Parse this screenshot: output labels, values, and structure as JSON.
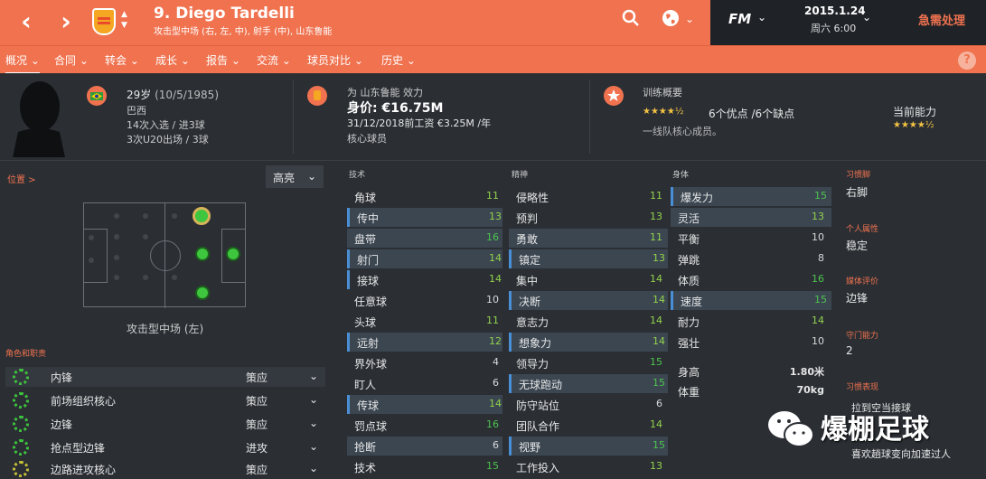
{
  "header": {
    "title": "9. Diego Tardelli",
    "subtitle": "攻击型中场 (右, 左, 中), 射手 (中), 山东鲁能",
    "fm_label": "FM",
    "date": "2015.1.24",
    "day_time": "周六 6:00",
    "urgent_label": "急需处理"
  },
  "menu": [
    "概况",
    "合同",
    "转会",
    "成长",
    "报告",
    "交流",
    "球员对比",
    "历史"
  ],
  "info": {
    "age": "29岁",
    "birth": "(10/5/1985)",
    "nation": "巴西",
    "caps": "14次入选 / 进3球",
    "u20": "3次U20出场 / 3球",
    "club_line": "为 山东鲁能 效力",
    "value_label": "身价: €16.75M",
    "contract": "31/12/2018前工资 €3.25M /年",
    "squad_status": "核心球员",
    "training_label": "训练概要",
    "strengths": "6个优点 /6个缺点",
    "training_sub": "一线队核心成员。",
    "current_ability_label": "当前能力"
  },
  "position_panel": {
    "title": "位置 >",
    "dropdown": "高亮",
    "position_label": "攻击型中场 (左)",
    "roles_title": "角色和职责",
    "roles": [
      {
        "name": "内锋",
        "duty": "策应"
      },
      {
        "name": "前场组织核心",
        "duty": "策应"
      },
      {
        "name": "边锋",
        "duty": "策应"
      },
      {
        "name": "抢点型边锋",
        "duty": "进攻"
      },
      {
        "name": "边路进攻核心",
        "duty": "策应"
      }
    ]
  },
  "attributes": {
    "technical_head": "技术",
    "mental_head": "精神",
    "physical_head": "身体",
    "technical": [
      {
        "name": "角球",
        "value": "11"
      },
      {
        "name": "传中",
        "value": "13"
      },
      {
        "name": "盘带",
        "value": "16"
      },
      {
        "name": "射门",
        "value": "14"
      },
      {
        "name": "接球",
        "value": "14"
      },
      {
        "name": "任意球",
        "value": "10"
      },
      {
        "name": "头球",
        "value": "11"
      },
      {
        "name": "远射",
        "value": "12"
      },
      {
        "name": "界外球",
        "value": "4"
      },
      {
        "name": "盯人",
        "value": "6"
      },
      {
        "name": "传球",
        "value": "14"
      },
      {
        "name": "罚点球",
        "value": "16"
      },
      {
        "name": "抢断",
        "value": "6"
      },
      {
        "name": "技术",
        "value": "15"
      }
    ],
    "mental": [
      {
        "name": "侵略性",
        "value": "11"
      },
      {
        "name": "预判",
        "value": "13"
      },
      {
        "name": "勇敢",
        "value": "11"
      },
      {
        "name": "镇定",
        "value": "13"
      },
      {
        "name": "集中",
        "value": "14"
      },
      {
        "name": "决断",
        "value": "14"
      },
      {
        "name": "意志力",
        "value": "14"
      },
      {
        "name": "想象力",
        "value": "14"
      },
      {
        "name": "领导力",
        "value": "15"
      },
      {
        "name": "无球跑动",
        "value": "15"
      },
      {
        "name": "防守站位",
        "value": "6"
      },
      {
        "name": "团队合作",
        "value": "14"
      },
      {
        "name": "视野",
        "value": "15"
      },
      {
        "name": "工作投入",
        "value": "13"
      }
    ],
    "physical": [
      {
        "name": "爆发力",
        "value": "15"
      },
      {
        "name": "灵活",
        "value": "13"
      },
      {
        "name": "平衡",
        "value": "10"
      },
      {
        "name": "弹跳",
        "value": "8"
      },
      {
        "name": "体质",
        "value": "16"
      },
      {
        "name": "速度",
        "value": "15"
      },
      {
        "name": "耐力",
        "value": "14"
      },
      {
        "name": "强壮",
        "value": "10"
      }
    ],
    "height_label": "身高",
    "height_value": "1.80米",
    "weight_label": "体重",
    "weight_value": "70kg"
  },
  "right_panel": {
    "foot_title": "习惯脚",
    "foot_value": "右脚",
    "personality_title": "个人属性",
    "personality_value": "稳定",
    "media_title": "媒体评价",
    "media_value": "边锋",
    "gk_title": "守门能力",
    "gk_value": "2",
    "habits_title": "习惯表现",
    "habit1": "拉到空当接球",
    "habit2": "喜欢趟球变向加速过人"
  },
  "watermark_text": "爆棚足球"
}
